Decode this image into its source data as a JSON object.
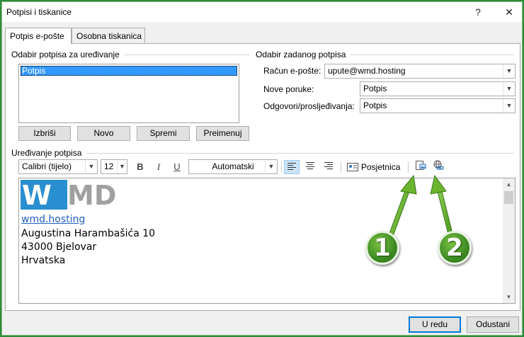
{
  "window": {
    "title": "Potpisi i tiskanice",
    "help_label": "?",
    "close_label": "✕"
  },
  "tabs": [
    {
      "label": "Potpis e-pošte",
      "active": true
    },
    {
      "label": "Osobna tiskanica",
      "active": false
    }
  ],
  "select_section": {
    "heading": "Odabir potpisa za uređivanje",
    "items": [
      "Potpis"
    ],
    "buttons": {
      "delete": "Izbriši",
      "new": "Novo",
      "save": "Spremi",
      "rename": "Preimenuj"
    }
  },
  "default_section": {
    "heading": "Odabir zadanog potpisa",
    "account_label": "Račun e-pošte:",
    "account_value": "upute@wmd.hosting",
    "new_messages_label": "Nove poruke:",
    "new_messages_value": "Potpis",
    "replies_label": "Odgovori/prosljeđivanja:",
    "replies_value": "Potpis"
  },
  "edit_section": {
    "heading": "Uređivanje potpisa",
    "font": "Calibri (tijelo)",
    "size": "12",
    "bold": "B",
    "italic": "I",
    "underline": "U",
    "color": "Automatski",
    "business_card": "Posjetnica",
    "icons": [
      "align-left-icon",
      "align-center-icon",
      "align-right-icon",
      "business-card-icon",
      "insert-picture-icon",
      "insert-hyperlink-icon"
    ]
  },
  "signature": {
    "logo_text": "WMD",
    "link": "wmd.hosting",
    "lines": [
      "Augustina Harambašića 10",
      "43000 Bjelovar",
      "Hrvatska"
    ]
  },
  "annotations": {
    "badge_1": "1",
    "badge_2": "2"
  },
  "footer": {
    "ok": "U redu",
    "cancel": "Odustani"
  },
  "colors": {
    "accent": "#0078d7",
    "selection": "#3399ff",
    "logo_blue": "#2a8fd0",
    "logo_gray": "#a0a0a0",
    "arrow_green": "#6ab42e"
  }
}
